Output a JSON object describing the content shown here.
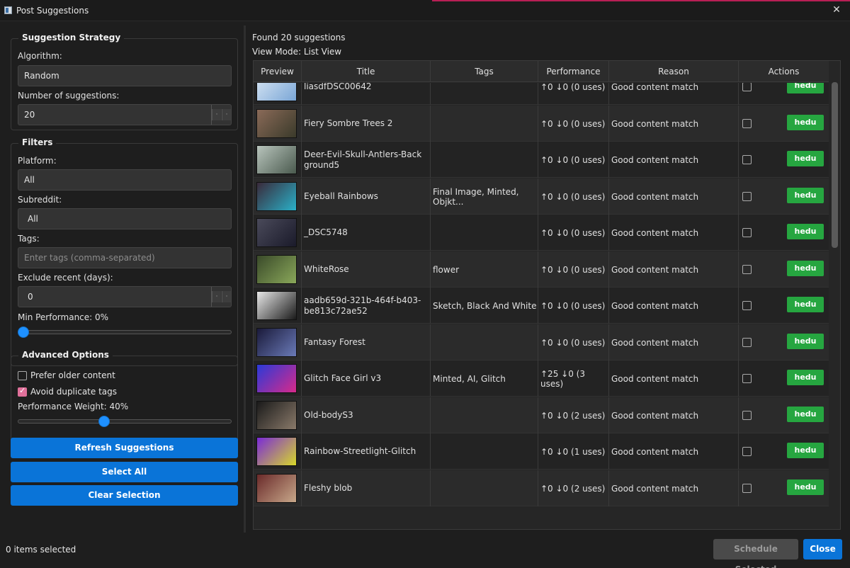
{
  "window": {
    "title": "Post Suggestions",
    "close": "✕"
  },
  "strategy": {
    "title": "Suggestion Strategy",
    "algorithm_label": "Algorithm:",
    "algorithm_value": "Random",
    "count_label": "Number of suggestions:",
    "count_value": "20"
  },
  "filters": {
    "title": "Filters",
    "platform_label": "Platform:",
    "platform_value": "All",
    "subreddit_label": "Subreddit:",
    "subreddit_value": "All",
    "tags_label": "Tags:",
    "tags_placeholder": "Enter tags (comma-separated)",
    "exclude_label": "Exclude recent (days):",
    "exclude_value": "0",
    "min_perf_label": "Min Performance: 0%",
    "min_perf_fraction": 0.0
  },
  "advanced": {
    "title": "Advanced Options",
    "prefer_older_label": "Prefer older content",
    "prefer_older_checked": false,
    "avoid_dup_label": "Avoid duplicate tags",
    "avoid_dup_checked": true,
    "weight_label": "Performance Weight: 40%",
    "weight_fraction": 0.4
  },
  "buttons": {
    "refresh": "Refresh Suggestions",
    "select_all": "Select All",
    "clear": "Clear Selection",
    "schedule": "Schedule Selected",
    "close": "Close"
  },
  "results": {
    "found": "Found 20 suggestions",
    "view_mode": "View Mode: List View",
    "columns": [
      "Preview",
      "Title",
      "Tags",
      "Performance",
      "Reason",
      "Actions"
    ],
    "action_label": "hedu",
    "rows": [
      {
        "title": "liasdfDSC00642",
        "tags": "",
        "perf": "↑0 ↓0 (0 uses)",
        "reason": "Good content match",
        "thumb": [
          "#dbe8f5",
          "#7aa6d6"
        ]
      },
      {
        "title": "Fiery Sombre Trees 2",
        "tags": "",
        "perf": "↑0 ↓0 (0 uses)",
        "reason": "Good content match",
        "thumb": [
          "#8a6a58",
          "#3a3a2a"
        ]
      },
      {
        "title": "Deer-Evil-Skull-Antlers-Background5",
        "tags": "",
        "perf": "↑0 ↓0 (0 uses)",
        "reason": "Good content match",
        "thumb": [
          "#b8c4bc",
          "#4a5a4e"
        ]
      },
      {
        "title": "Eyeball Rainbows",
        "tags": "Final Image, Minted, Objkt...",
        "perf": "↑0 ↓0 (0 uses)",
        "reason": "Good content match",
        "thumb": [
          "#3a2a3a",
          "#2ab0c8"
        ]
      },
      {
        "title": "_DSC5748",
        "tags": "",
        "perf": "↑0 ↓0 (0 uses)",
        "reason": "Good content match",
        "thumb": [
          "#4a4a5a",
          "#1a1a2a"
        ]
      },
      {
        "title": "WhiteRose",
        "tags": "flower",
        "perf": "↑0 ↓0 (0 uses)",
        "reason": "Good content match",
        "thumb": [
          "#3a4a2a",
          "#8aa85a"
        ]
      },
      {
        "title": "aadb659d-321b-464f-b403-be813c72ae52",
        "tags": "Sketch, Black And White",
        "perf": "↑0 ↓0 (0 uses)",
        "reason": "Good content match",
        "thumb": [
          "#e8e8e8",
          "#1a1a1a"
        ]
      },
      {
        "title": "Fantasy Forest",
        "tags": "",
        "perf": "↑0 ↓0 (0 uses)",
        "reason": "Good content match",
        "thumb": [
          "#1a1a3a",
          "#6a7ab8"
        ]
      },
      {
        "title": "Glitch Face Girl v3",
        "tags": "Minted, AI, Glitch",
        "perf": "↑25 ↓0 (3 uses)",
        "reason": "Good content match",
        "thumb": [
          "#2a3ad8",
          "#d82a8a"
        ]
      },
      {
        "title": "Old-bodyS3",
        "tags": "",
        "perf": "↑0 ↓0 (2 uses)",
        "reason": "Good content match",
        "thumb": [
          "#1a1a1a",
          "#8a7a6a"
        ]
      },
      {
        "title": "Rainbow-Streetlight-Glitch",
        "tags": "",
        "perf": "↑0 ↓0 (1 uses)",
        "reason": "Good content match",
        "thumb": [
          "#7a2ad8",
          "#d8d82a"
        ]
      },
      {
        "title": "Fleshy blob",
        "tags": "",
        "perf": "↑0 ↓0 (2 uses)",
        "reason": "Good content match",
        "thumb": [
          "#6a2a2a",
          "#c8a88a"
        ]
      }
    ]
  },
  "footer": {
    "selected": "0 items selected"
  }
}
